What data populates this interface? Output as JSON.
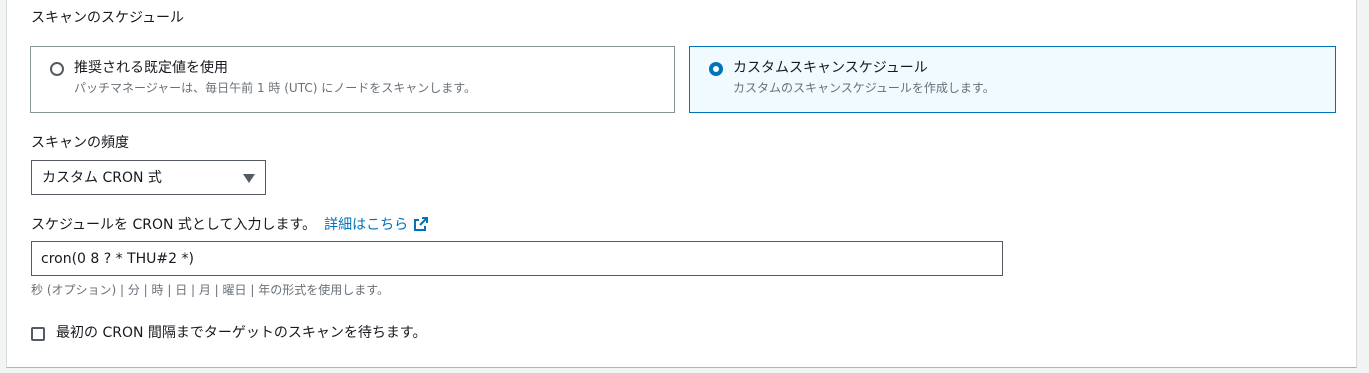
{
  "schedule": {
    "label": "スキャンのスケジュール",
    "options": [
      {
        "title": "推奨される既定値を使用",
        "description": "パッチマネージャーは、毎日午前 1 時 (UTC) にノードをスキャンします。",
        "selected": false
      },
      {
        "title": "カスタムスキャンスケジュール",
        "description": "カスタムのスキャンスケジュールを作成します。",
        "selected": true
      }
    ]
  },
  "frequency": {
    "label": "スキャンの頻度",
    "selected_value": "カスタム CRON 式",
    "dropdown_icon": "caret-down-icon"
  },
  "cron": {
    "label": "スケジュールを CRON 式として入力します。",
    "link_text": "詳細はこちら",
    "link_icon": "external-link-icon",
    "value": "cron(0 8 ? * THU#2 *)",
    "hint": "秒 (オプション) | 分 | 時 | 日 | 月 | 曜日 | 年の形式を使用します。"
  },
  "wait_option": {
    "label": "最初の CRON 間隔までターゲットのスキャンを待ちます。",
    "checked": false
  },
  "colors": {
    "accent": "#0073bb",
    "selected_tile_bg": "#f1faff",
    "secondary_text": "#687078"
  }
}
